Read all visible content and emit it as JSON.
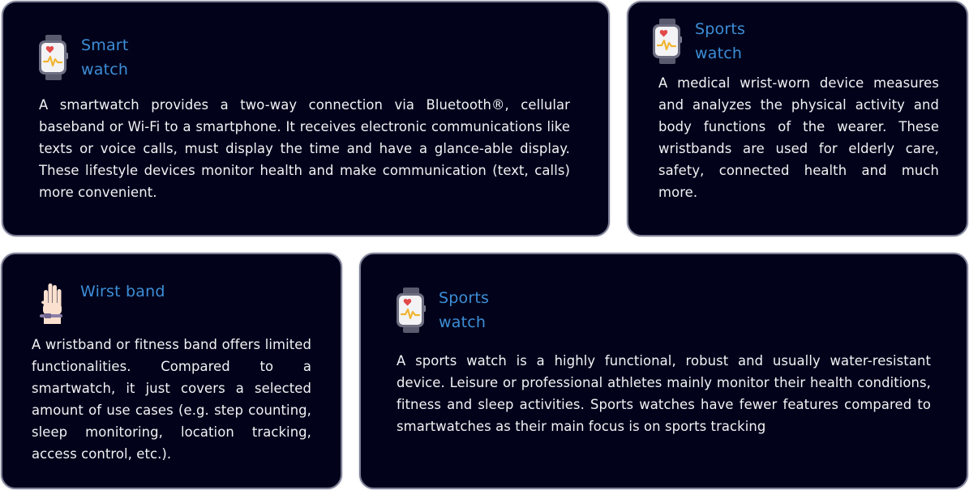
{
  "cards": [
    {
      "title": "Smart watch",
      "icon": "smartwatch-icon",
      "body": "A smartwatch provides a two-way connection via Bluetooth®, cellular baseband or Wi-Fi to a smartphone. It receives electronic communications like texts or voice calls, must display the time and have a glance-able display. These lifestyle devices monitor health and make communication (text, calls) more convenient."
    },
    {
      "title": "Sports watch",
      "icon": "smartwatch-icon",
      "body": "A medical wrist-worn device measures and analyzes the physical activity and body functions of the wearer. These wristbands are used for elderly care, safety, connected health and much more."
    },
    {
      "title": "Wirst band",
      "icon": "wristband-hand-icon",
      "body": "A wristband or fitness band offers limited functionalities. Compared to a smartwatch, it just covers a selected amount of use cases (e.g. step counting, sleep monitoring, location tracking, access control, etc.)."
    },
    {
      "title": "Sports watch",
      "icon": "smartwatch-icon",
      "body": "A sports watch is a highly functional, robust and usually water-resistant device. Leisure or professional athletes mainly monitor their health conditions, fitness and sleep activities. Sports watches have fewer features compared to smartwatches as their main focus is on sports tracking"
    }
  ],
  "colors": {
    "card_background": "#02031b",
    "card_border": "#7b7e95",
    "title": "#3d8ed6",
    "body_text": "#f2f2f4"
  }
}
